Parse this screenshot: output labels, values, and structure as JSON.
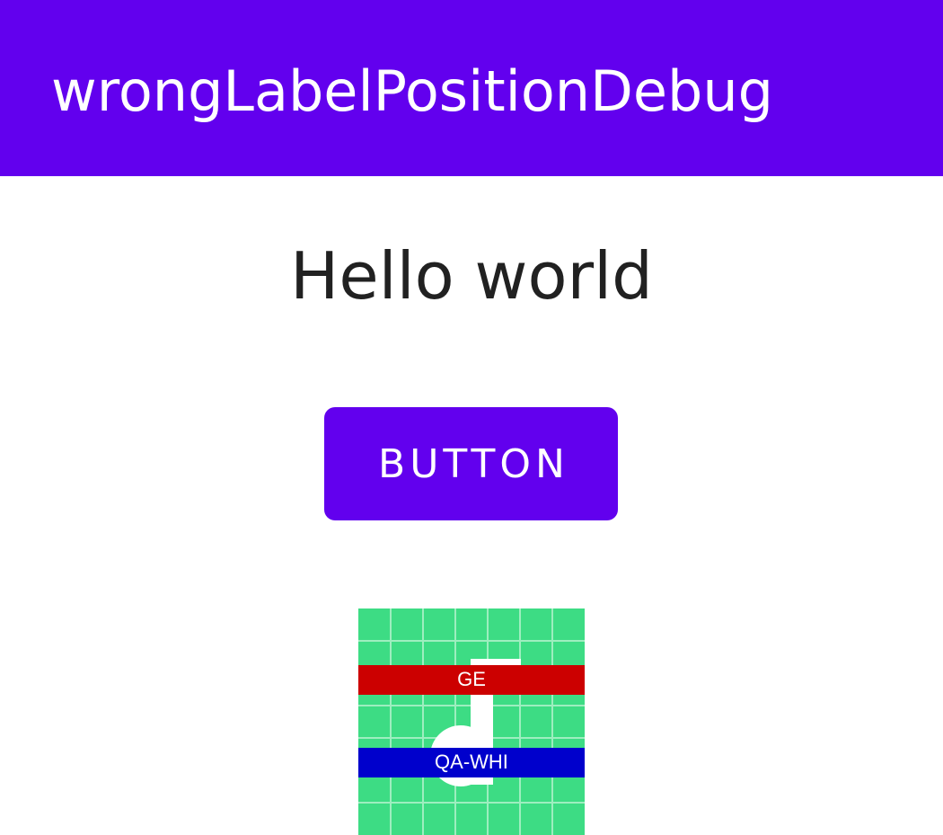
{
  "app_bar": {
    "title": "wrongLabelPositionDebug",
    "color": "#6200ee"
  },
  "main": {
    "hello_text": "Hello world",
    "button_label": "BUTTON",
    "button_color": "#6200ee"
  },
  "image": {
    "icon": "music-note-icon",
    "background_color": "#3ddc84",
    "top_label": "GE",
    "top_label_color": "#cc0000",
    "bottom_label": "QA-WHI",
    "bottom_label_color": "#0000cc"
  }
}
